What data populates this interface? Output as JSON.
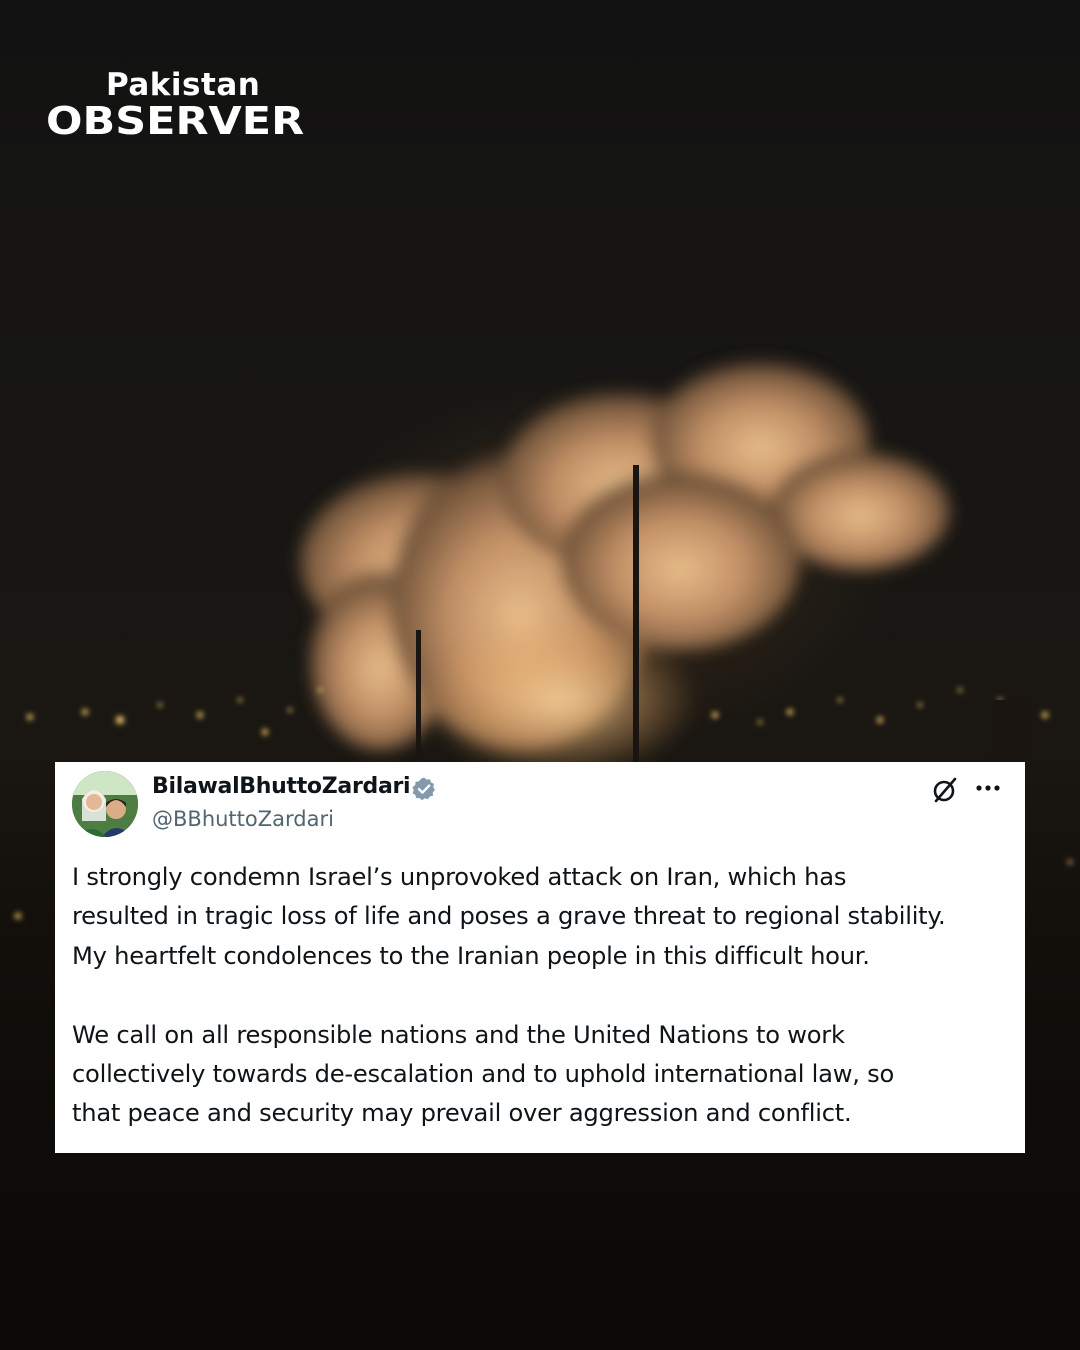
{
  "brand": {
    "line1": "Pakistan",
    "line2": "OBSERVER"
  },
  "tweet": {
    "display_name": "BilawalBhuttoZardari",
    "handle": "@BBhuttoZardari",
    "verified": true,
    "paragraphs": [
      [
        "I strongly condemn Israel’s unprovoked attack on Iran, which has",
        "resulted in tragic loss of life and poses a grave threat to regional stability.",
        "My heartfelt condolences to the Iranian people in this difficult hour."
      ],
      [
        "We call on all responsible nations and the United Nations to work",
        "collectively towards de-escalation and to uphold international law, so",
        "that peace and security may prevail over aggression and conflict."
      ]
    ],
    "icons": [
      "grok-icon",
      "more-icon",
      "verified-badge-icon"
    ],
    "colors": {
      "verified": "#829aab",
      "text": "#0f1419",
      "muted": "#536471"
    }
  }
}
